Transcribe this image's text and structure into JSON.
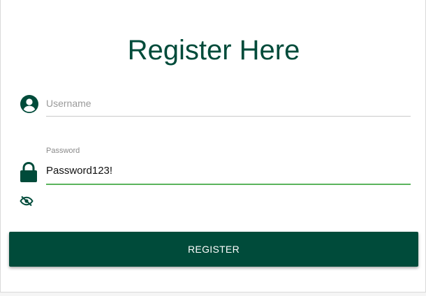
{
  "form": {
    "title": "Register Here",
    "username": {
      "placeholder": "Username",
      "value": ""
    },
    "password": {
      "label": "Password",
      "value": "Password123!"
    },
    "register_label": "REGISTER"
  },
  "icons": {
    "username": "account-circle-icon",
    "password": "lock-icon",
    "visibility": "eye-off-icon"
  },
  "colors": {
    "primary": "#004b3a",
    "focus_underline": "#5ab45c"
  }
}
